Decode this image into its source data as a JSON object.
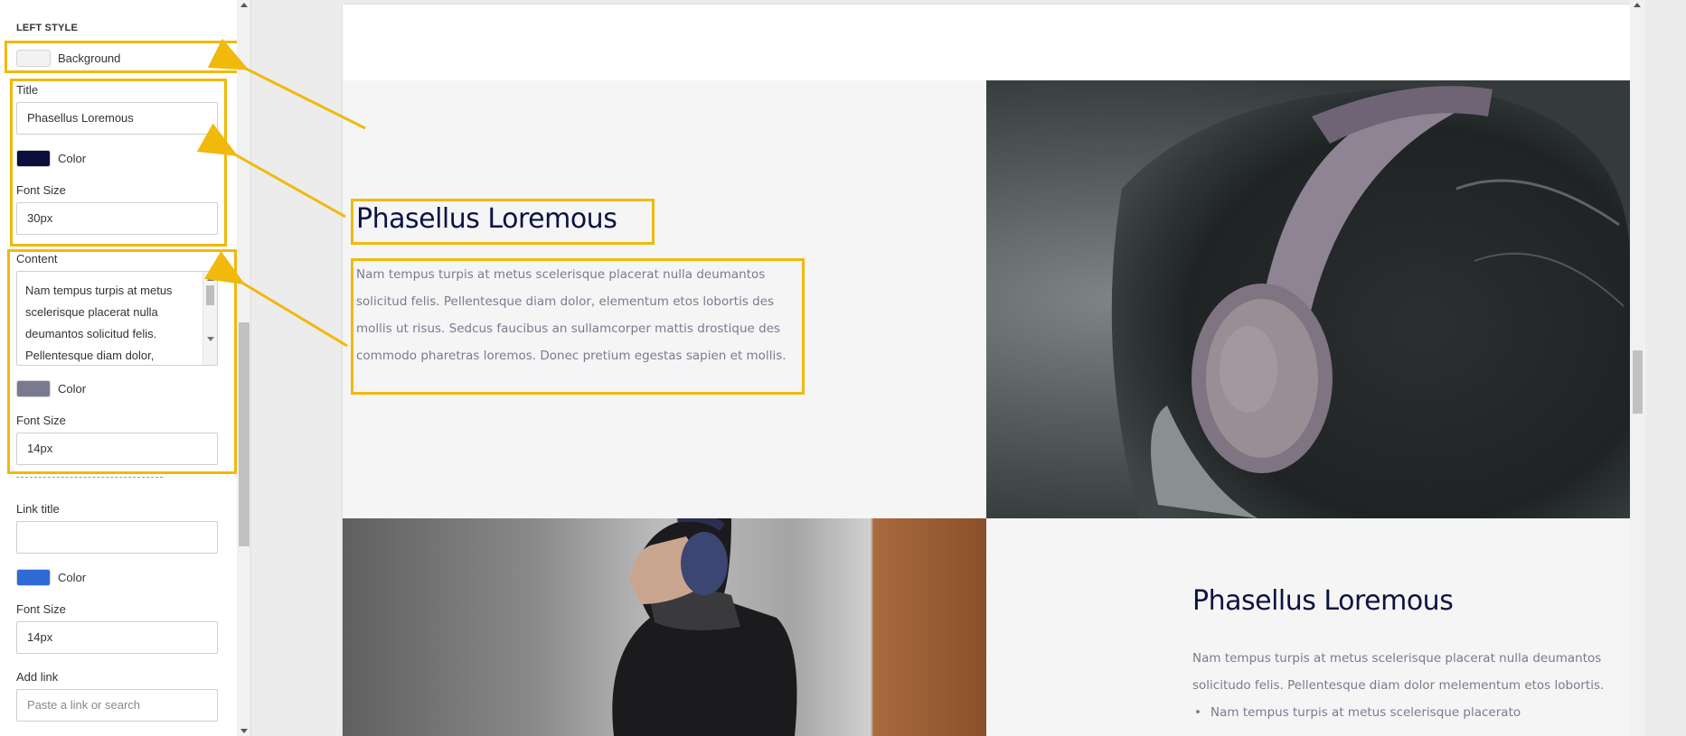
{
  "panel": {
    "section_title": "LEFT STYLE",
    "background_label": "Background",
    "background_color": "#f2f2f2",
    "title_label": "Title",
    "title_value": "Phasellus Loremous",
    "title_color_label": "Color",
    "title_color": "#0a0f3d",
    "title_font_size_label": "Font Size",
    "title_font_size_value": "30px",
    "content_label": "Content",
    "content_value": "Nam tempus turpis at metus scelerisque placerat nulla deumantos solicitud felis. Pellentesque diam dolor,",
    "content_color_label": "Color",
    "content_color": "#7a7a8e",
    "content_font_size_label": "Font Size",
    "content_font_size_value": "14px",
    "link_title_label": "Link title",
    "link_title_value": "",
    "link_color_label": "Color",
    "link_color": "#2e6bd6",
    "link_font_size_label": "Font Size",
    "link_font_size_value": "14px",
    "add_link_label": "Add link",
    "add_link_placeholder": "Paste a link or search"
  },
  "canvas": {
    "block1": {
      "title": "Phasellus Loremous",
      "content": "Nam tempus turpis at metus scelerisque placerat nulla deumantos solicitud felis. Pellentesque diam dolor, elementum etos lobortis des mollis ut risus. Sedcus faucibus an sullamcorper mattis drostique des commodo pharetras loremos. Donec pretium egestas sapien et mollis."
    },
    "block2": {
      "title": "Phasellus Loremous",
      "content": "Nam tempus turpis at metus scelerisque placerat nulla deumantos solicitudo felis. Pellentesque diam dolor melementum etos lobortis.",
      "bullets": [
        "Nam tempus turpis at metus scelerisque placerato"
      ]
    }
  },
  "colors": {
    "highlight": "#f0b90b"
  },
  "icons": [
    "scroll-up-arrow-icon",
    "scroll-down-arrow-icon"
  ]
}
